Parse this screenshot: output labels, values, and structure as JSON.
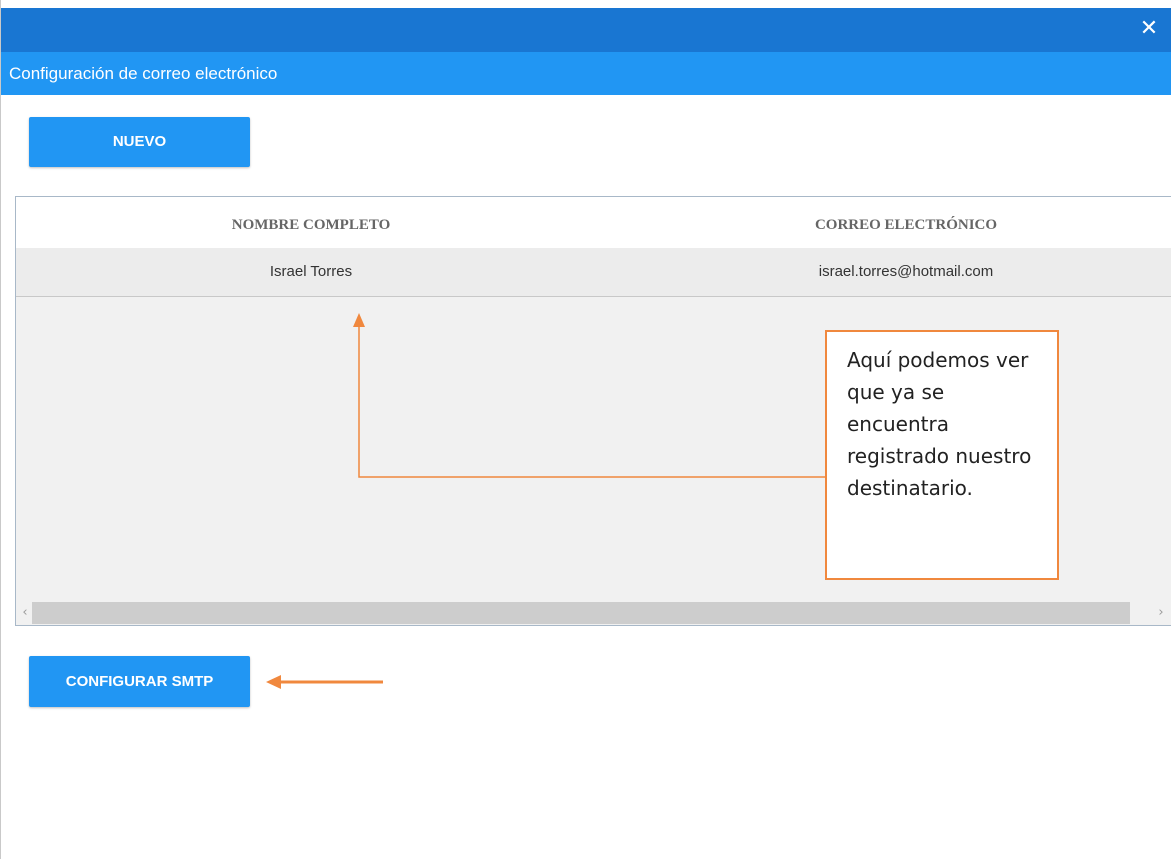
{
  "dialog": {
    "title": "Configuración de correo electrónico",
    "close_glyph": "✕"
  },
  "toolbar": {
    "new_label": "NUEVO"
  },
  "grid": {
    "columns": [
      "NOMBRE COMPLETO",
      "CORREO ELECTRÓNICO"
    ],
    "rows": [
      {
        "name": "Israel Torres",
        "email": "israel.torres@hotmail.com"
      }
    ],
    "scroll_left_glyph": "‹",
    "scroll_right_glyph": "›"
  },
  "callout": {
    "text": "Aquí podemos ver que ya se encuentra registrado nuestro destinatario."
  },
  "footer": {
    "smtp_label": "CONFIGURAR SMTP"
  },
  "colors": {
    "topbar": "#1976d2",
    "titlebar": "#2196f3",
    "button": "#2196f3",
    "annotation": "#f0883e"
  }
}
